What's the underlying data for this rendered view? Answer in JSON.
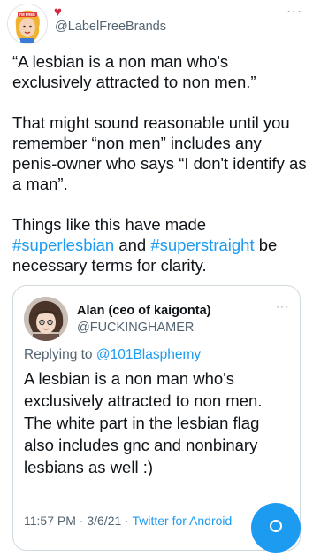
{
  "header": {
    "handle": "@LabelFreeBrands",
    "avatar_badge": "I'M FREE",
    "heart": "♥",
    "more": "···"
  },
  "tweet": {
    "paragraphs": {
      "p1": "“A lesbian is a non man who's exclusively attracted to non men.”",
      "p2": "That might sound reasonable until you remember “non men” includes any penis-owner who says “I don't identify as a man”.",
      "p3_before": "Things like this have made ",
      "hashtag1": "#superlesbian",
      "p3_middle": " and ",
      "hashtag2": "#superstraight",
      "p3_after": " be necessary terms for clarity."
    }
  },
  "quoted": {
    "name": "Alan (ceo of kaigonta)",
    "handle": "@FUCKINGHAMER",
    "more": "···",
    "reply_prefix": "Replying to ",
    "reply_mention": "@101Blasphemy",
    "text": "A lesbian is a non man who's exclusively attracted to non men. The white part in the lesbian flag also includes gnc and nonbinary lesbians as well :)",
    "time": "11:57 PM",
    "date": "3/6/21",
    "separator": "·",
    "client": "Twitter for Android"
  },
  "colors": {
    "accent": "#1d9bf0",
    "text": "#0f1419",
    "secondary": "#536471",
    "heart": "#d7263d",
    "border": "#cfd9de"
  },
  "icons": {
    "author_avatar": "cartoon-woman-avatar",
    "heart": "heart-icon",
    "more": "more-icon",
    "quoted_avatar": "anime-avatar",
    "compose": "compose-button"
  }
}
